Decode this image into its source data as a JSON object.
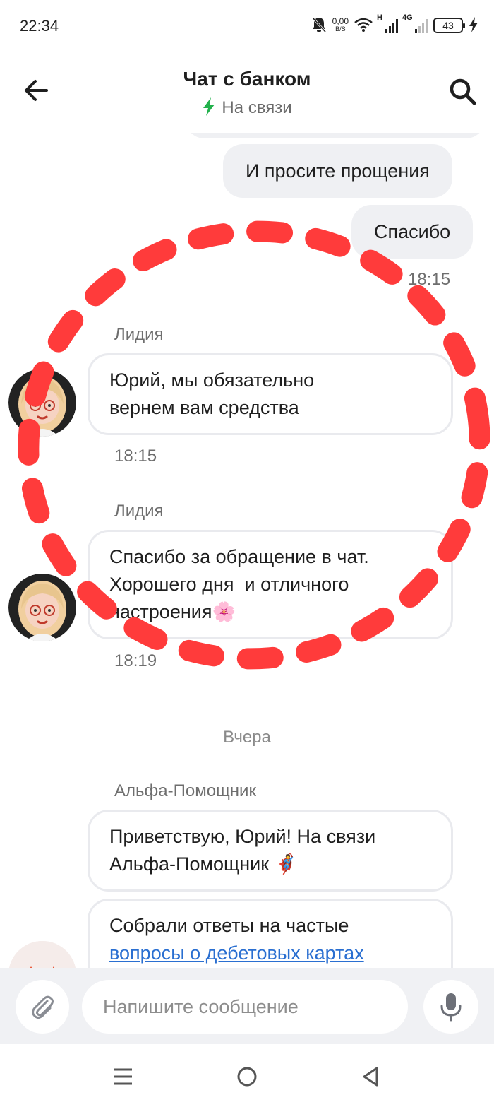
{
  "status_bar": {
    "time": "22:34",
    "speed_value": "0,00",
    "speed_unit": "B/S",
    "signal1_label": "H",
    "signal2_label": "4G",
    "battery": "43",
    "icons": [
      "bell-off-icon",
      "wifi-icon",
      "signal-icon",
      "battery-icon",
      "charging-icon"
    ]
  },
  "header": {
    "title": "Чат с банком",
    "status": "На связи",
    "status_color": "#22b14c"
  },
  "messages": {
    "out": [
      {
        "text": "И просите прощения"
      },
      {
        "text": "Спасибо"
      }
    ],
    "out_time": "18:15",
    "in1": {
      "sender": "Лидия",
      "line1": "Юрий, мы обязательно",
      "line2": "вернем вам средства",
      "time": "18:15"
    },
    "in2": {
      "sender": "Лидия",
      "line1": "Спасибо за обращение в чат.",
      "line2": "Хорошего дня  и отличного",
      "line3": "настроения",
      "emoji": "🌸",
      "time": "18:19"
    },
    "date_divider": "Вчера",
    "in3": {
      "sender": "Альфа-Помощник",
      "line1": "Приветствую, Юрий! На связи",
      "line2": "Альфа-Помощник",
      "emoji": "🦸"
    },
    "in4": {
      "line1": "Собрали ответы на частые",
      "link": "вопросы о дебетовых картах"
    }
  },
  "composer": {
    "placeholder": "Напишите сообщение"
  },
  "colors": {
    "annotation": "#ff3b3b",
    "link": "#2a6fd1",
    "out_bubble": "#eff0f3"
  }
}
